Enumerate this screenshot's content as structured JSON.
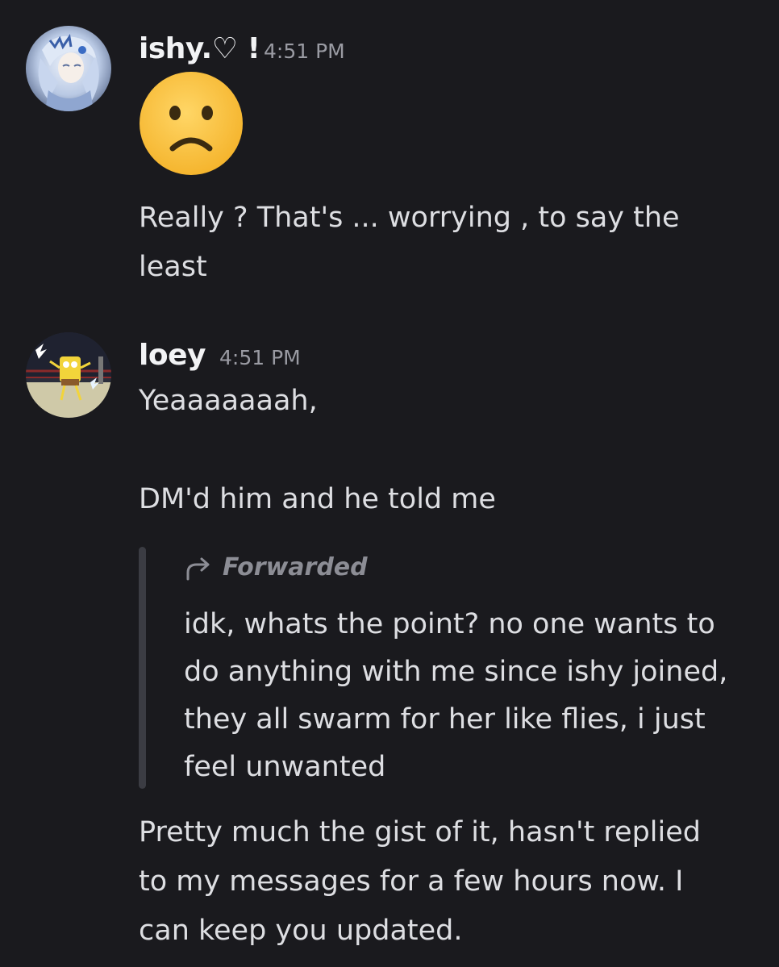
{
  "messages": [
    {
      "username": "ishy.♡ !",
      "timestamp": "4:51 PM",
      "emoji": "slightly-frowning-face",
      "lines": [
        "Really ? That's ... worrying , to say the",
        "least"
      ]
    },
    {
      "username": "loey",
      "timestamp": "4:51 PM",
      "line1": "Yeaaaaaaah,",
      "line2": "DM'd him and he told me",
      "forwarded": {
        "label": "Forwarded",
        "icon": "forward-arrow-icon",
        "lines": [
          "idk, whats the point? no one wants to",
          "do anything with me since ishy joined,",
          "they all swarm for her like flies, i just",
          "feel unwanted"
        ]
      },
      "after_lines": [
        "Pretty much the gist of it, hasn't replied",
        "to my messages for a few hours now. I",
        "can keep you updated."
      ]
    }
  ]
}
